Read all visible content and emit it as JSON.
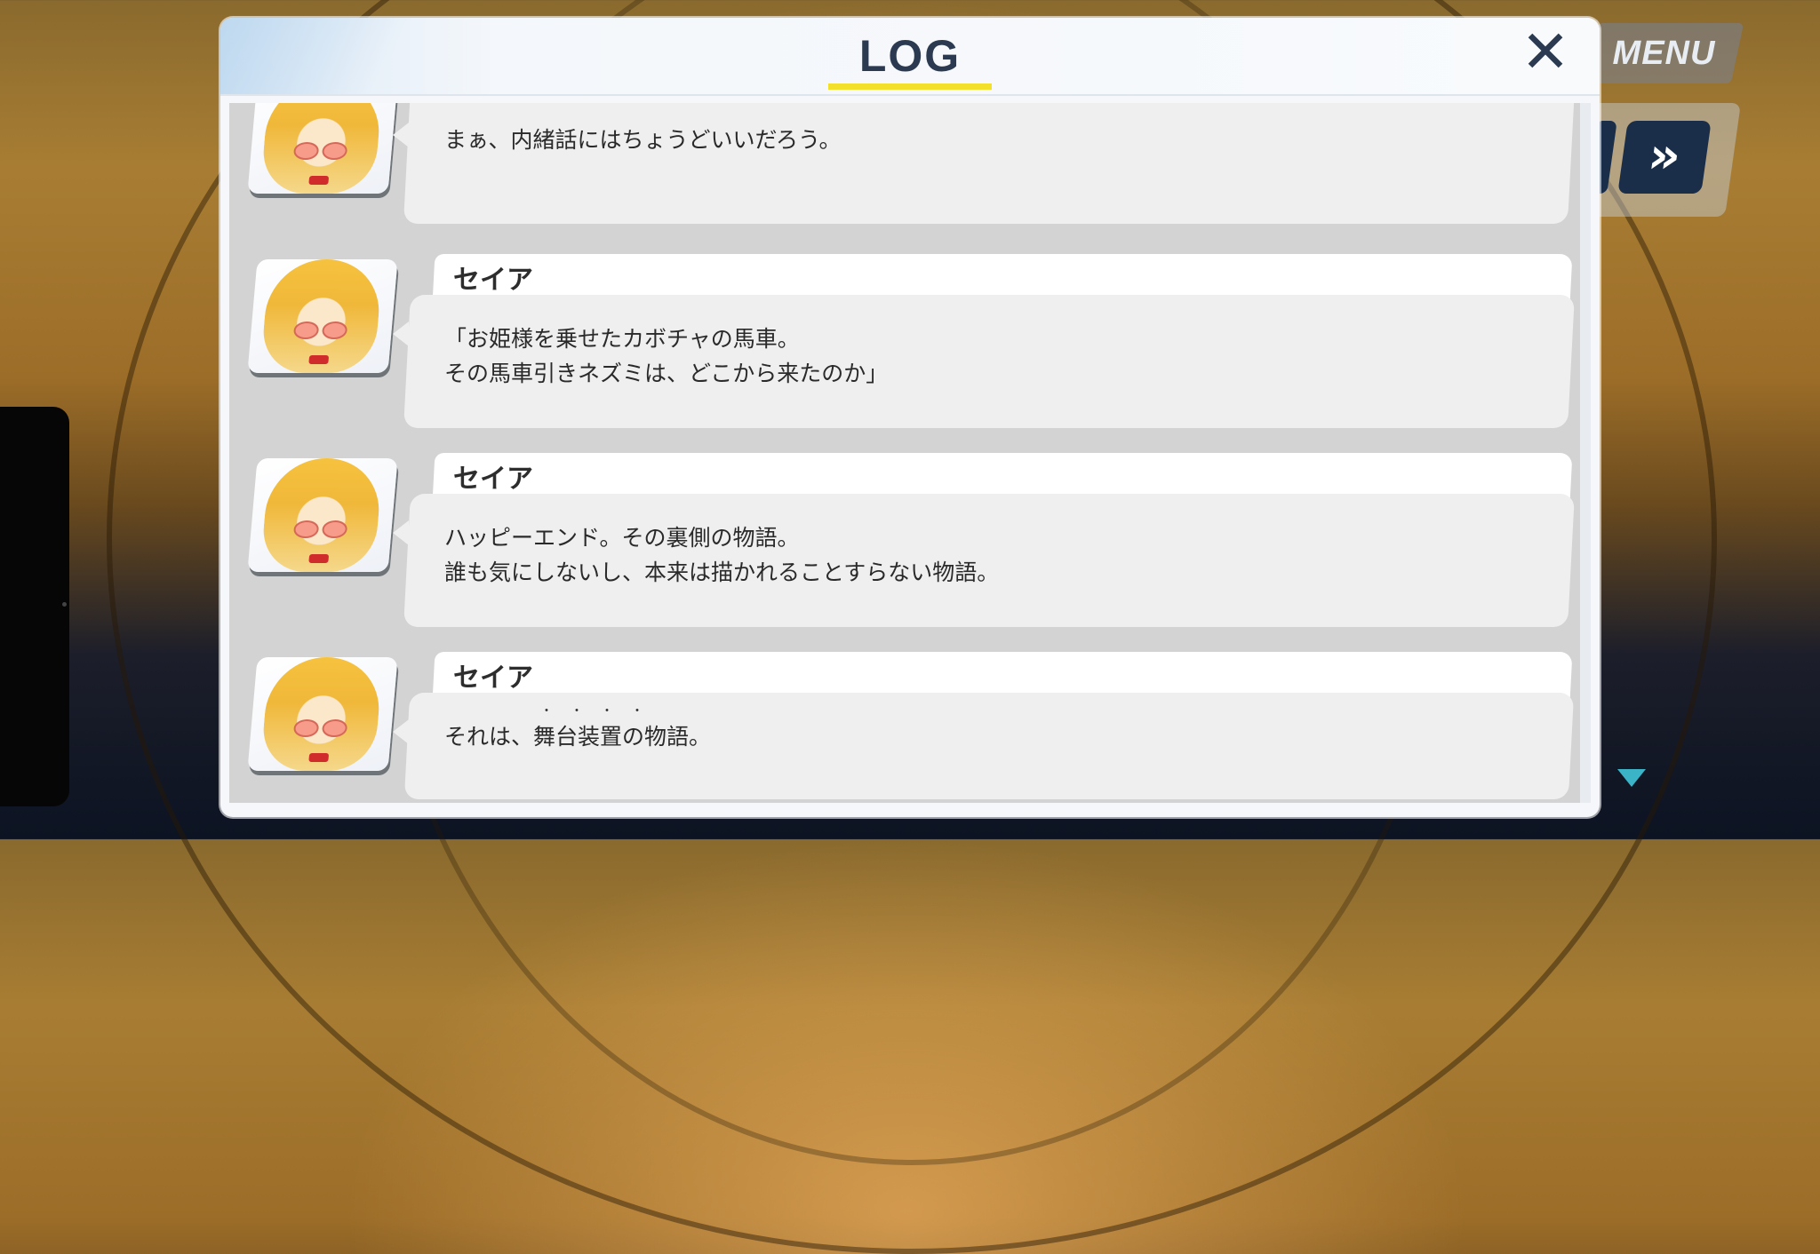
{
  "hud": {
    "menu_label": "MENU",
    "skip_icon": "»"
  },
  "log": {
    "title": "LOG",
    "close_icon": "✕",
    "entries": [
      {
        "speaker": "",
        "lines": [
          "まぁ、内緒話にはちょうどいいだろう。"
        ]
      },
      {
        "speaker": "セイア",
        "lines": [
          "「お姫様を乗せたカボチャの馬車。",
          "その馬車引きネズミは、どこから来たのか」"
        ]
      },
      {
        "speaker": "セイア",
        "lines": [
          "ハッピーエンド。その裏側の物語。",
          "誰も気にしないし、本来は描かれることすらない物語。"
        ]
      },
      {
        "speaker": "セイア",
        "lines": [
          "それは、舞台装置の物語。"
        ],
        "ruby": "・・・・"
      }
    ]
  },
  "colors": {
    "accent_underline": "#f2e02a",
    "title_text": "#2b3a50",
    "skip_button": "#1a2e4a",
    "scroll_arrow": "#3bb4c8"
  }
}
